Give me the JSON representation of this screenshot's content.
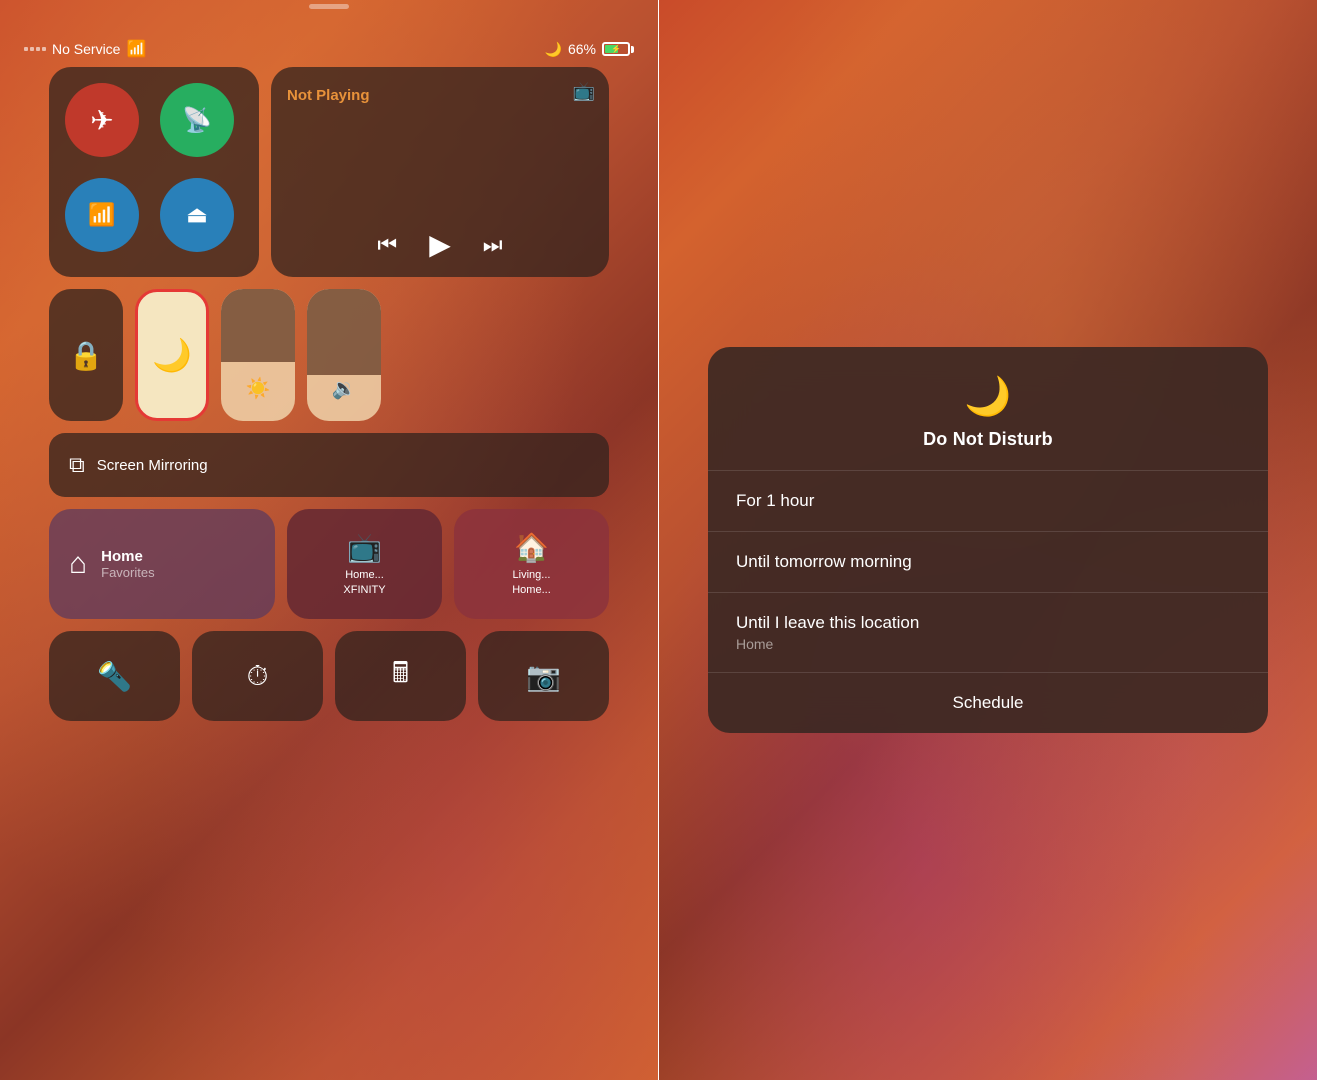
{
  "left": {
    "status_bar": {
      "signal": "No Service",
      "wifi": true,
      "battery_percent": "66%",
      "moon": "🌙"
    },
    "connectivity": {
      "airplane_mode": true,
      "cellular": true,
      "wifi": true,
      "bluetooth": true
    },
    "now_playing": {
      "label": "Not Playing",
      "airplay": true
    },
    "toggles": {
      "rotation_lock": "⊙",
      "dnd": "🌙",
      "dnd_active": true
    },
    "sliders": {
      "brightness_label": "☀",
      "volume_label": "🔉"
    },
    "screen_mirror": {
      "label": "Screen Mirroring"
    },
    "home": {
      "title": "Home",
      "subtitle": "Favorites",
      "app1_label": "Home...\nXFINITY",
      "app2_label": "Living...\nHome..."
    },
    "tools": {
      "flashlight": "🔦",
      "timer": "⏱",
      "calculator": "🖩",
      "camera": "📷"
    }
  },
  "right": {
    "dnd_popup": {
      "moon_icon": "🌙",
      "title": "Do Not Disturb",
      "option1": {
        "main": "For 1 hour",
        "sub": ""
      },
      "option2": {
        "main": "Until tomorrow morning",
        "sub": ""
      },
      "option3": {
        "main": "Until I leave this location",
        "sub": "Home"
      },
      "schedule": {
        "label": "Schedule"
      }
    }
  }
}
